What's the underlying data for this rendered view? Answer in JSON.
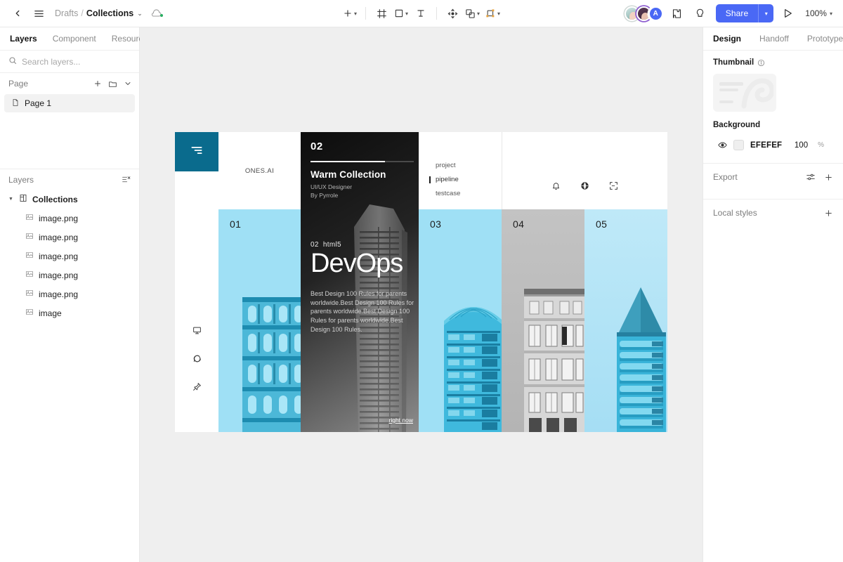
{
  "topbar": {
    "back_icon": "chevron-left-icon",
    "menu_icon": "hamburger-menu-icon",
    "breadcrumb": {
      "parent": "Drafts",
      "separator": "/",
      "current": "Collections",
      "chevron": "⌄"
    },
    "cloud_icon": "cloud-sync-icon",
    "tools": [
      {
        "name": "add-tool",
        "icon": "plus-icon",
        "caret": true
      },
      {
        "name": "frame-tool",
        "icon": "frame-icon",
        "caret": false
      },
      {
        "name": "shape-tool",
        "icon": "rectangle-icon",
        "caret": true
      },
      {
        "name": "text-tool",
        "icon": "text-icon",
        "caret": false
      },
      {
        "name": "move-tool",
        "icon": "move-gizmo-icon",
        "caret": false
      },
      {
        "name": "boolean-tool",
        "icon": "layers-stack-icon",
        "caret": true
      },
      {
        "name": "component-tool",
        "icon": "component-crop-icon",
        "caret": true
      }
    ],
    "avatars": [
      {
        "name": "avatar-user-1",
        "initial": ""
      },
      {
        "name": "avatar-user-2",
        "initial": ""
      },
      {
        "name": "avatar-user-3",
        "initial": "A"
      }
    ],
    "plugin_icon": "plugin-puzzle-icon",
    "idea_icon": "lightbulb-icon",
    "share_label": "Share",
    "share_caret": "⌄",
    "present_icon": "play-present-icon",
    "zoom_level": "100%",
    "zoom_caret": "⌄"
  },
  "left_panel": {
    "tabs": [
      {
        "label": "Layers",
        "active": true
      },
      {
        "label": "Component",
        "active": false
      },
      {
        "label": "Resource",
        "active": false
      }
    ],
    "search": {
      "placeholder": "Search layers...",
      "value": "",
      "icon": "search-icon"
    },
    "page_section": {
      "title": "Page",
      "add_icon": "plus-icon",
      "folder_icon": "folder-icon",
      "collapse_icon": "chevron-down-icon",
      "items": [
        {
          "label": "Page 1",
          "icon": "page-file-icon",
          "selected": true
        }
      ]
    },
    "layers_section": {
      "title": "Layers",
      "options_icon": "layer-options-icon",
      "tree": [
        {
          "label": "Collections",
          "icon": "frame-icon",
          "depth": 0,
          "expanded": true
        },
        {
          "label": "image.png",
          "icon": "image-icon",
          "depth": 1
        },
        {
          "label": "image.png",
          "icon": "image-icon",
          "depth": 1
        },
        {
          "label": "image.png",
          "icon": "image-icon",
          "depth": 1
        },
        {
          "label": "image.png",
          "icon": "image-icon",
          "depth": 1
        },
        {
          "label": "image.png",
          "icon": "image-icon",
          "depth": 1
        },
        {
          "label": "image",
          "icon": "image-icon",
          "depth": 1
        }
      ]
    }
  },
  "right_panel": {
    "tabs": [
      {
        "label": "Design",
        "active": true
      },
      {
        "label": "Handoff",
        "active": false
      },
      {
        "label": "Prototype",
        "active": false
      }
    ],
    "thumbnail": {
      "label": "Thumbnail",
      "info_icon": "info-icon"
    },
    "background": {
      "label": "Background",
      "visibility_icon": "eye-icon",
      "color_hex": "EFEFEF",
      "opacity": "100",
      "opacity_unit": "%"
    },
    "export": {
      "label": "Export",
      "settings_icon": "sliders-icon",
      "add_icon": "plus-icon"
    },
    "local_styles": {
      "label": "Local styles",
      "add_icon": "plus-icon"
    }
  },
  "canvas": {
    "background_color": "#EFEFEF",
    "design": {
      "logo_box": {
        "icon": "align-right-menu-icon",
        "color": "#0A6B8D"
      },
      "brand_text": "ONES.AI",
      "nav": [
        {
          "label": "project",
          "active": false
        },
        {
          "label": "pipeline",
          "active": true
        },
        {
          "label": "testcase",
          "active": false
        }
      ],
      "header_icons": [
        {
          "name": "bell-icon"
        },
        {
          "name": "globe-icon"
        },
        {
          "name": "scan-fullscreen-icon"
        }
      ],
      "rail_icons": [
        {
          "name": "present-monitor-icon"
        },
        {
          "name": "comment-icon"
        },
        {
          "name": "pin-icon"
        }
      ],
      "feature_card": {
        "number": "02",
        "title": "Warm Collection",
        "role": "UI/UX Designer",
        "author": "By Pyrrole",
        "progress_percent": 72,
        "kicker_number": "02",
        "kicker_tag": "html5",
        "headline": "DevOps",
        "body": "Best Design 100 Rules for parents worldwide.Best Design 100 Rules for parents worldwide.Best Design 100 Rules for parents worldwide.Best Design 100 Rules.",
        "link": "right now"
      },
      "cards": [
        {
          "number": "01",
          "theme": "light-blue",
          "image": "classical-building"
        },
        {
          "number": "03",
          "theme": "light-blue",
          "image": "curved-roof-building"
        },
        {
          "number": "04",
          "theme": "gray",
          "image": "gray-facade-building"
        },
        {
          "number": "05",
          "theme": "light-blue",
          "image": "spire-tower-building"
        }
      ]
    }
  }
}
